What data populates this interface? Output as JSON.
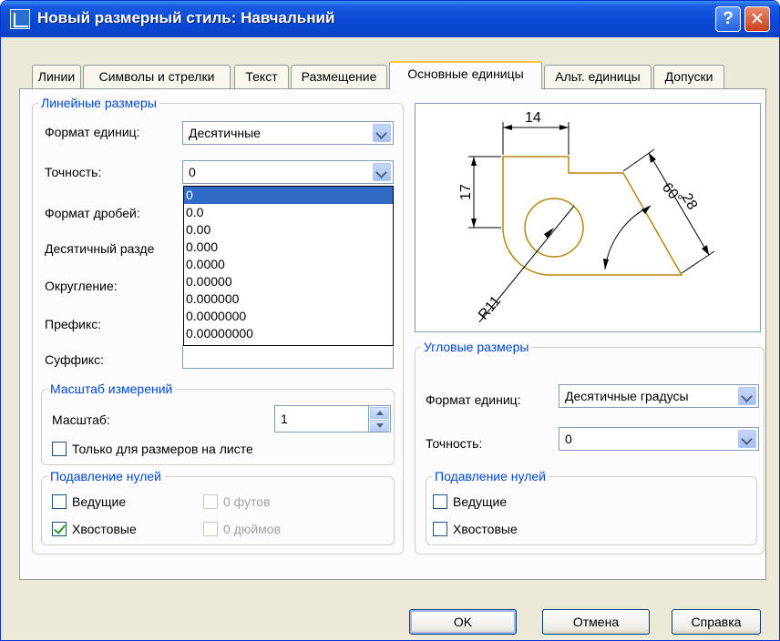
{
  "window": {
    "title": "Новый размерный стиль: Навчальний",
    "help_label": "?",
    "close_label": "✕"
  },
  "tabs": [
    {
      "label": "Линии"
    },
    {
      "label": "Символы и стрелки"
    },
    {
      "label": "Текст"
    },
    {
      "label": "Размещение"
    },
    {
      "label": "Основные единицы",
      "active": true
    },
    {
      "label": "Альт. единицы"
    },
    {
      "label": "Допуски"
    }
  ],
  "linear": {
    "title": "Линейные размеры",
    "unit_format_label": "Формат единиц:",
    "unit_format_value": "Десятичные",
    "precision_label": "Точность:",
    "precision_value": "0",
    "fraction_format_label": "Формат дробей:",
    "decimal_separator_label": "Десятичный  разде",
    "roundoff_label": "Округление:",
    "prefix_label": "Префикс:",
    "suffix_label": "Суффикс:",
    "precision_options": [
      "0",
      "0.0",
      "0.00",
      "0.000",
      "0.0000",
      "0.00000",
      "0.000000",
      "0.0000000",
      "0.00000000"
    ],
    "precision_selected_index": 0
  },
  "measurement_scale": {
    "title": "Масштаб измерений",
    "scale_label": "Масштаб:",
    "scale_value": "1",
    "layout_only_label": "Только для размеров на листе",
    "layout_only_checked": false
  },
  "zero_suppression_linear": {
    "title": "Подавление нулей",
    "leading_label": "Ведущие",
    "leading_checked": false,
    "trailing_label": "Хвостовые",
    "trailing_checked": true,
    "feet_label": "0 футов",
    "inches_label": "0 дюймов"
  },
  "preview": {
    "dim_top": "14",
    "dim_left": "17",
    "dim_radius": "R11",
    "dim_angle": "60°",
    "dim_diag": "28"
  },
  "angular": {
    "title": "Угловые размеры",
    "unit_format_label": "Формат единиц:",
    "unit_format_value": "Десятичные градусы",
    "precision_label": "Точность:",
    "precision_value": "0"
  },
  "zero_suppression_angular": {
    "title": "Подавление нулей",
    "leading_label": "Ведущие",
    "leading_checked": false,
    "trailing_label": "Хвостовые",
    "trailing_checked": false
  },
  "buttons": {
    "ok": "OK",
    "cancel": "Отмена",
    "help": "Справка"
  },
  "colors": {
    "title_bar": "#0a4ad6",
    "group_title": "#0046d5",
    "selection": "#316ac5",
    "preview_lines": "#b8860b"
  }
}
